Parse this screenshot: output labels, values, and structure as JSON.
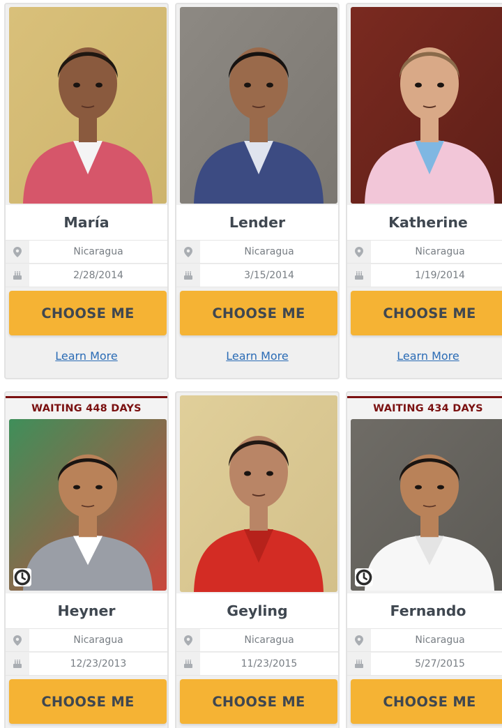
{
  "cards": [
    {
      "name": "María",
      "country": "Nicaragua",
      "birthdate": "2/28/2014",
      "cta": "CHOOSE ME",
      "learn_more": "Learn More",
      "waiting": "",
      "photo": {
        "bg": "#d9c07a",
        "bg2": "#cdb46d",
        "shirt": "#d6566a",
        "inner": "#f4f4f4",
        "skin": "#8a5a3e",
        "hair": "#1f1711"
      }
    },
    {
      "name": "Lender",
      "country": "Nicaragua",
      "birthdate": "3/15/2014",
      "cta": "CHOOSE ME",
      "learn_more": "Learn More",
      "waiting": "",
      "photo": {
        "bg": "#8d8983",
        "bg2": "#7b7771",
        "shirt": "#3c4b82",
        "inner": "#dfe3ee",
        "skin": "#9a6a4b",
        "hair": "#161210"
      }
    },
    {
      "name": "Katherine",
      "country": "Nicaragua",
      "birthdate": "1/19/2014",
      "cta": "CHOOSE ME",
      "learn_more": "Learn More",
      "waiting": "",
      "photo": {
        "bg": "#7a2a20",
        "bg2": "#5e1f18",
        "shirt": "#f2c6d8",
        "inner": "#7fb7e2",
        "skin": "#d9a987",
        "hair": "#8a6a4a"
      }
    },
    {
      "name": "Heyner",
      "country": "Nicaragua",
      "birthdate": "12/23/2013",
      "cta": "CHOOSE ME",
      "learn_more": "",
      "waiting": "WAITING 448 DAYS",
      "photo": {
        "bg": "#3f8f5a",
        "bg2": "#c9483d",
        "shirt": "#9a9ea6",
        "inner": "#ffffff",
        "skin": "#b98259",
        "hair": "#1a1411"
      }
    },
    {
      "name": "Geyling",
      "country": "Nicaragua",
      "birthdate": "11/23/2015",
      "cta": "CHOOSE ME",
      "learn_more": "",
      "waiting": "",
      "photo": {
        "bg": "#e0cf9a",
        "bg2": "#d3c08a",
        "shirt": "#d32c24",
        "inner": "#b6221b",
        "skin": "#b98566",
        "hair": "#221813"
      }
    },
    {
      "name": "Fernando",
      "country": "Nicaragua",
      "birthdate": "5/27/2015",
      "cta": "CHOOSE ME",
      "learn_more": "",
      "waiting": "WAITING 434 DAYS",
      "photo": {
        "bg": "#6f6c66",
        "bg2": "#5c5a55",
        "shirt": "#f7f7f7",
        "inner": "#e4e4e4",
        "skin": "#b98259",
        "hair": "#1a1411"
      }
    }
  ],
  "colors": {
    "accent": "#f5b334",
    "name_text": "#3f4750",
    "link": "#2a6bb5",
    "waiting_text": "#7a1010"
  },
  "icons": {
    "location": "map-pin-icon",
    "birthday": "birthday-cake-icon",
    "waiting": "clock-icon"
  }
}
